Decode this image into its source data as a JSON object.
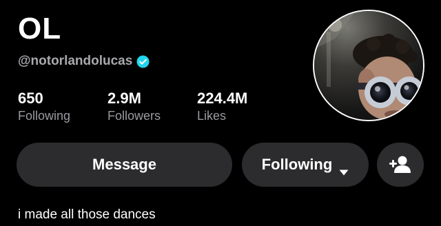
{
  "profile": {
    "display_name": "OL",
    "handle": "@notorlandolucas",
    "verified": true,
    "bio": "i made all those dances"
  },
  "stats": {
    "following": {
      "value": "650",
      "label": "Following"
    },
    "followers": {
      "value": "2.9M",
      "label": "Followers"
    },
    "likes": {
      "value": "224.4M",
      "label": "Likes"
    }
  },
  "buttons": {
    "message_label": "Message",
    "following_label": "Following",
    "add_friend_icon": "add-user-icon",
    "following_dropdown_icon": "chevron-down-icon"
  },
  "colors": {
    "background": "#000000",
    "button_bg": "#2c2c2e",
    "secondary_text": "#a8a8ad",
    "verified_badge": "#20d5ec"
  }
}
